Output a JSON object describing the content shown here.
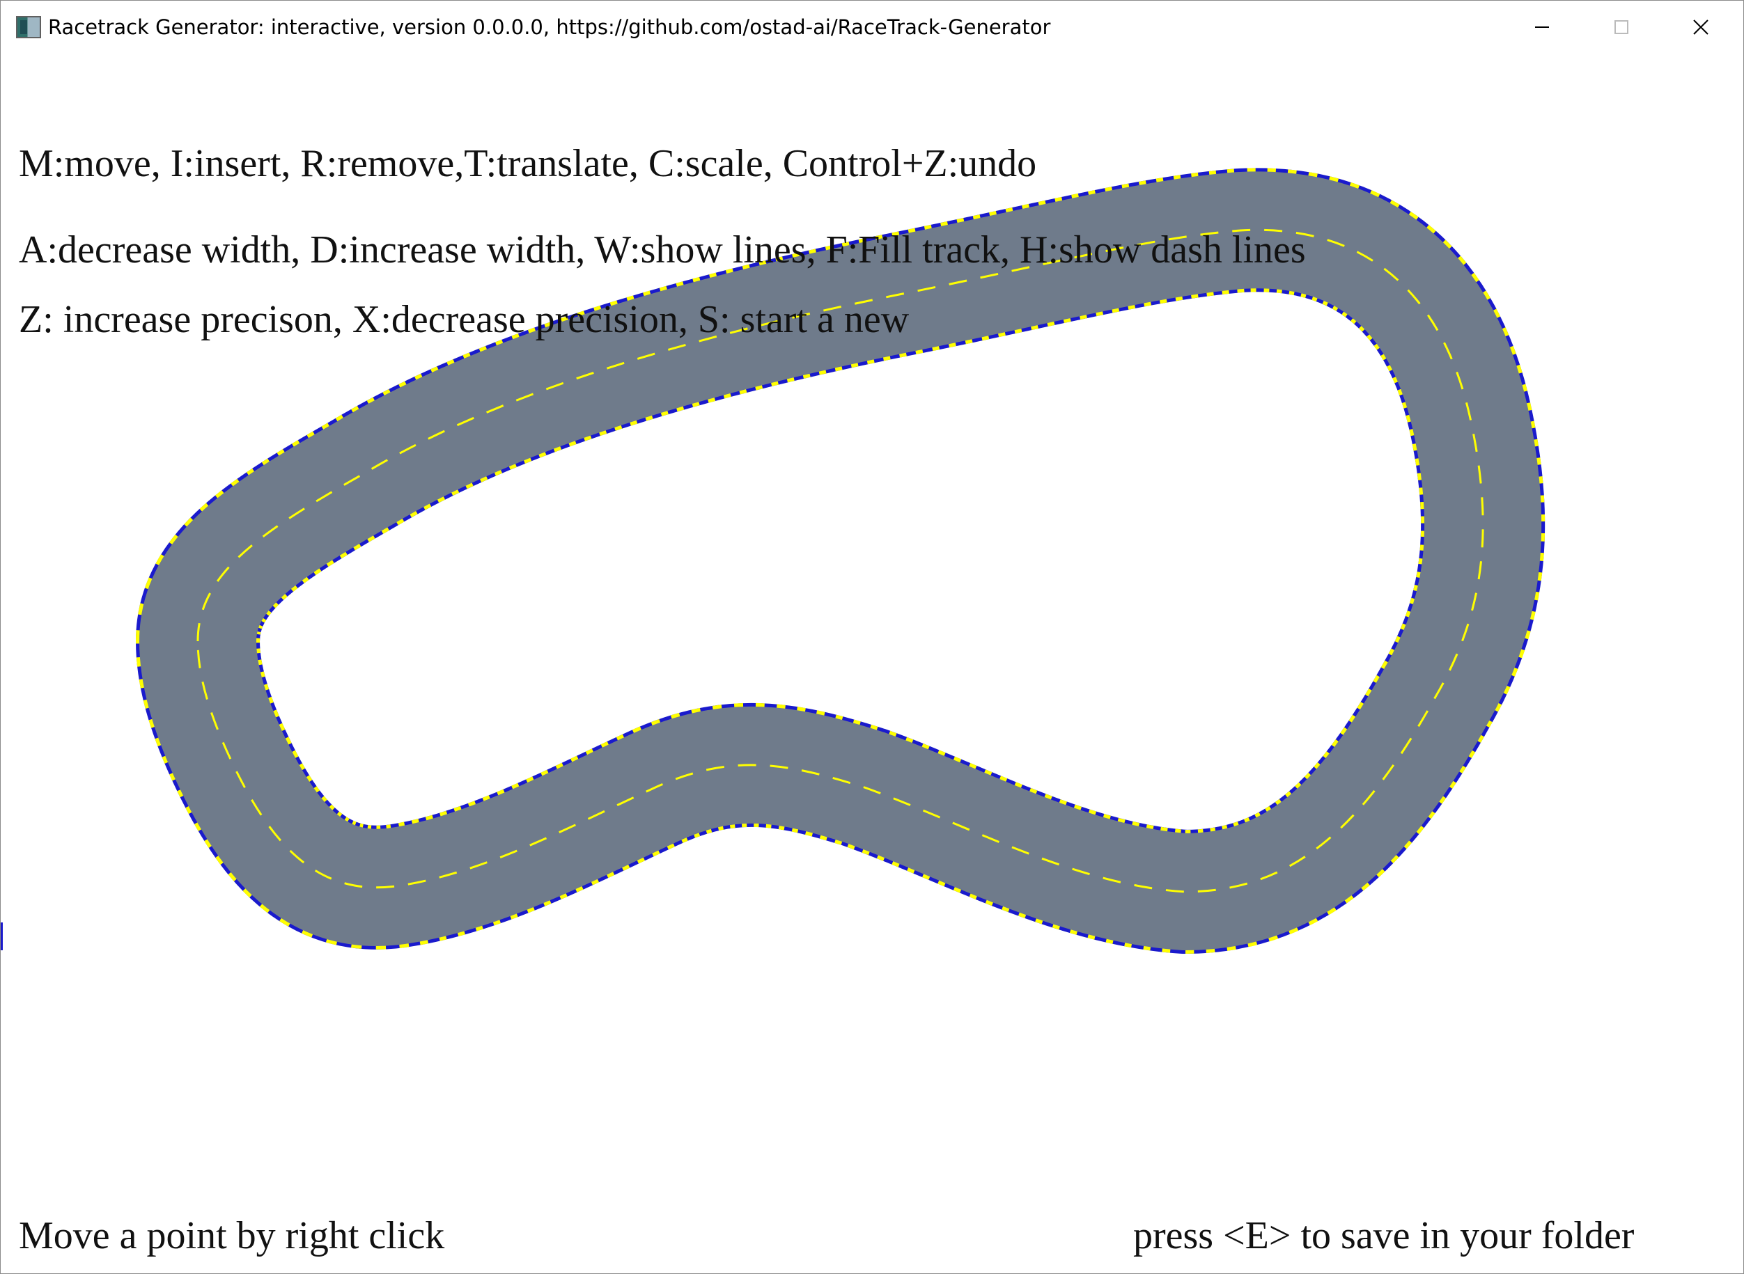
{
  "window": {
    "title": "Racetrack Generator: interactive, version 0.0.0.0, https://github.com/ostad-ai/RaceTrack-Generator",
    "icon": "app-icon",
    "controls": {
      "minimize_icon": "minimize-icon",
      "maximize_icon": "maximize-icon",
      "close_icon": "close-icon"
    }
  },
  "help": {
    "line1": "M:move, I:insert, R:remove,T:translate, C:scale, Control+Z:undo",
    "line2": "A:decrease width, D:increase width, W:show lines, F:Fill track, H:show dash lines",
    "line3": "Z: increase precison, X:decrease precision, S: start a new"
  },
  "footer": {
    "left": "Move a point by right click",
    "right": "press <E> to save in your folder"
  },
  "track": {
    "fill_color": "#6f7b8b",
    "border_color": "#1a1acc",
    "dash_color": "#ffff00",
    "background": "#ffffff"
  }
}
